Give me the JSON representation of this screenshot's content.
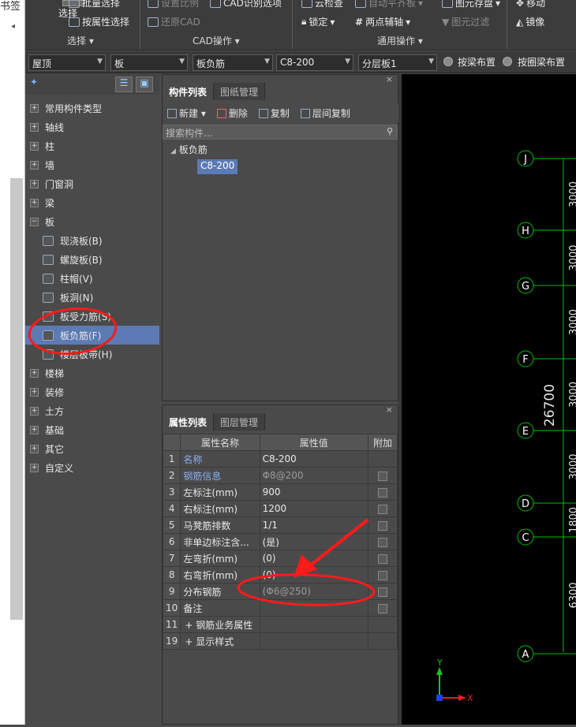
{
  "left_strip": {
    "tab_text": "书签"
  },
  "ribbon": {
    "select_big_label": "选择",
    "batch_select": "批量选择",
    "attr_select": "按属性选择",
    "set_scale": "设置比例",
    "cad_recognize_options": "CAD识别选项",
    "restore_cad": "还原CAD",
    "cloud_check": "云检查",
    "auto_flat_slab": "自动平齐板",
    "element_save": "图元存盘",
    "lock": "锁定",
    "two_point_axis": "两点辅轴",
    "element_filter": "图元过滤",
    "move": "移动",
    "mirror": "镜像",
    "group_select": "选择",
    "group_cad": "CAD操作",
    "group_general": "通用操作"
  },
  "combos": {
    "floor": "屋顶",
    "category": "板",
    "type": "板负筋",
    "component": "C8-200",
    "layer": "分层板1"
  },
  "radios": {
    "by_beam": "按梁布置",
    "by_ring_beam": "按圈梁布置"
  },
  "nav": {
    "items": [
      {
        "label": "常用构件类型"
      },
      {
        "label": "轴线"
      },
      {
        "label": "柱"
      },
      {
        "label": "墙"
      },
      {
        "label": "门窗洞"
      },
      {
        "label": "梁"
      },
      {
        "label": "板"
      },
      {
        "label": "现浇板(B)"
      },
      {
        "label": "螺旋板(B)"
      },
      {
        "label": "柱帽(V)"
      },
      {
        "label": "板洞(N)"
      },
      {
        "label": "板受力筋(S)"
      },
      {
        "label": "板负筋(F)"
      },
      {
        "label": "楼层板带(H)"
      },
      {
        "label": "楼梯"
      },
      {
        "label": "装修"
      },
      {
        "label": "土方"
      },
      {
        "label": "基础"
      },
      {
        "label": "其它"
      },
      {
        "label": "自定义"
      }
    ]
  },
  "component_panel": {
    "tab_active": "构件列表",
    "tab_other": "图纸管理",
    "btn_new": "新建",
    "btn_delete": "删除",
    "btn_copy": "复制",
    "btn_floor_copy": "层间复制",
    "search_placeholder": "搜索构件...",
    "tree_root": "板负筋",
    "tree_item": "C8-200"
  },
  "property_panel": {
    "tab_active": "属性列表",
    "tab_other": "图层管理",
    "col_name": "属性名称",
    "col_value": "属性值",
    "col_extra": "附加",
    "rows": [
      {
        "n": "1",
        "key": "名称",
        "value": "C8-200"
      },
      {
        "n": "2",
        "key": "钢筋信息",
        "value": "Φ8@200"
      },
      {
        "n": "3",
        "key": "左标注(mm)",
        "value": "900"
      },
      {
        "n": "4",
        "key": "右标注(mm)",
        "value": "1200"
      },
      {
        "n": "5",
        "key": "马凳筋排数",
        "value": "1/1"
      },
      {
        "n": "6",
        "key": "非单边标注含...",
        "value": "(是)"
      },
      {
        "n": "7",
        "key": "左弯折(mm)",
        "value": "(0)"
      },
      {
        "n": "8",
        "key": "右弯折(mm)",
        "value": "(0)"
      },
      {
        "n": "9",
        "key": "分布钢筋",
        "value": "(Φ6@250)"
      },
      {
        "n": "10",
        "key": "备注",
        "value": ""
      },
      {
        "n": "11",
        "key": "钢筋业务属性",
        "value": ""
      },
      {
        "n": "19",
        "key": "显示样式",
        "value": ""
      }
    ]
  },
  "canvas": {
    "axes": [
      "J",
      "H",
      "G",
      "F",
      "E",
      "D",
      "C",
      "A"
    ],
    "total_dim": "26700",
    "dims": [
      "3000",
      "3000",
      "3000",
      "3000",
      "3000",
      "1800",
      "6300"
    ],
    "ucs_x": "X",
    "ucs_y": "Y"
  },
  "colors": {
    "accent_selection": "#5c7ab3",
    "annotation_red": "#ff1a1a",
    "cad_green": "#00c000"
  }
}
